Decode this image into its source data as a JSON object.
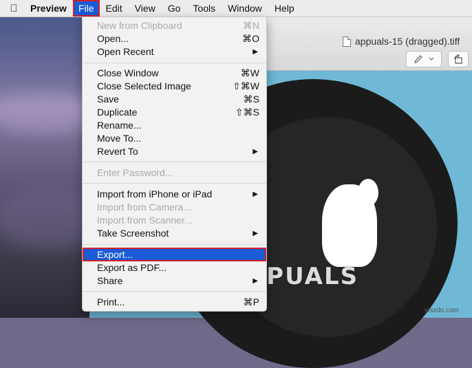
{
  "menubar": {
    "apple_icon": "apple-logo-icon",
    "app_name": "Preview",
    "items": [
      "File",
      "Edit",
      "View",
      "Go",
      "Tools",
      "Window",
      "Help"
    ],
    "active": "File"
  },
  "window": {
    "title": "appuals-15 (dragged).tiff",
    "icons": [
      "document-icon",
      "markup-pen-icon",
      "chevron-down-icon",
      "rotate-icon"
    ]
  },
  "file_menu": {
    "items": [
      {
        "label": "New from Clipboard",
        "shortcut": "⌘N",
        "enabled": false
      },
      {
        "label": "Open...",
        "shortcut": "⌘O",
        "enabled": true
      },
      {
        "label": "Open Recent",
        "submenu": true,
        "enabled": true
      },
      {
        "label": "Close Window",
        "shortcut": "⌘W",
        "enabled": true
      },
      {
        "label": "Close Selected Image",
        "shortcut": "⇧⌘W",
        "enabled": true
      },
      {
        "label": "Save",
        "shortcut": "⌘S",
        "enabled": true
      },
      {
        "label": "Duplicate",
        "shortcut": "⇧⌘S",
        "enabled": true
      },
      {
        "label": "Rename...",
        "enabled": true
      },
      {
        "label": "Move To...",
        "enabled": true
      },
      {
        "label": "Revert To",
        "submenu": true,
        "enabled": true
      },
      {
        "label": "Enter Password...",
        "enabled": false
      },
      {
        "label": "Import from iPhone or iPad",
        "submenu": true,
        "enabled": true
      },
      {
        "label": "Import from Camera...",
        "enabled": false
      },
      {
        "label": "Import from Scanner...",
        "enabled": false
      },
      {
        "label": "Take Screenshot",
        "submenu": true,
        "enabled": true
      },
      {
        "label": "Export...",
        "enabled": true,
        "selected": true
      },
      {
        "label": "Export as PDF...",
        "enabled": true
      },
      {
        "label": "Share",
        "submenu": true,
        "enabled": true
      },
      {
        "label": "Print...",
        "shortcut": "⌘P",
        "enabled": true
      }
    ]
  },
  "watermark": "A  PUALS",
  "credit": "wsxdn.com",
  "colors": {
    "selection_blue": "#1a5bd6",
    "highlight_red": "#d41f2b",
    "image_background": "#6fb9d6"
  }
}
